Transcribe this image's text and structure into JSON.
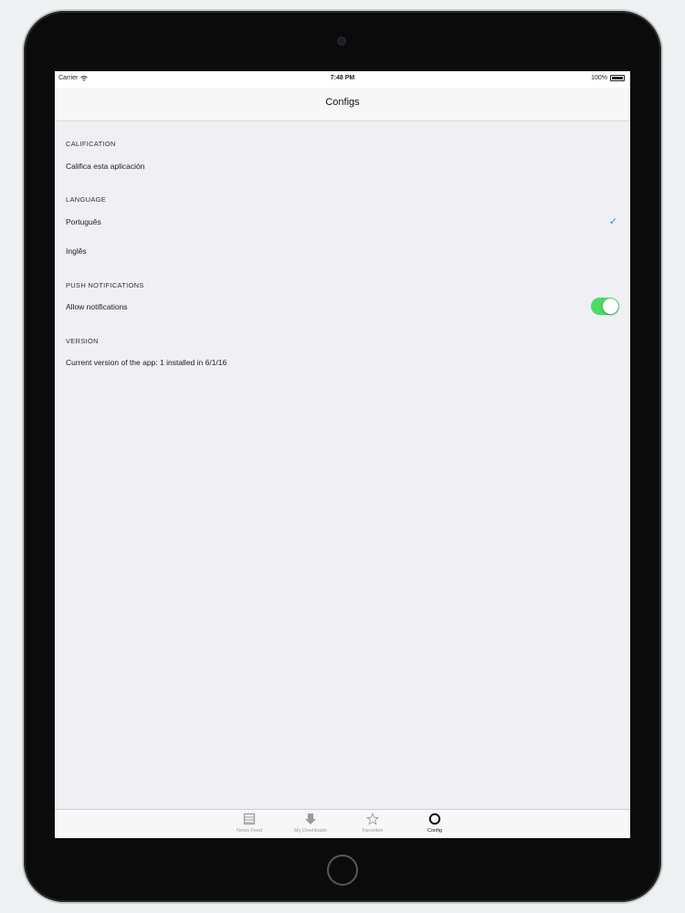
{
  "status_bar": {
    "carrier": "Carrier",
    "time": "7:48 PM",
    "battery": "100%"
  },
  "nav": {
    "title": "Configs"
  },
  "sections": {
    "calification": {
      "header": "CALIFICATION",
      "row_label": "Califica esta aplicación"
    },
    "language": {
      "header": "LANGUAGE",
      "options": [
        "Português",
        "Inglês"
      ],
      "selected": "Português"
    },
    "push": {
      "header": "PUSH NOTIFICATIONS",
      "row_label": "Allow notifications",
      "enabled": true
    },
    "version": {
      "header": "VERSION",
      "row_label": "Current version of the app: 1 installed in 6/1/16"
    }
  },
  "tab_bar": {
    "tabs": [
      {
        "label": "News Feed",
        "icon": "list-icon",
        "active": false
      },
      {
        "label": "My Downloads",
        "icon": "download-arrow-icon",
        "active": false
      },
      {
        "label": "Favorites",
        "icon": "star-icon",
        "active": false
      },
      {
        "label": "Config",
        "icon": "circle-icon",
        "active": true
      }
    ]
  },
  "colors": {
    "accent": "#2f7cf6",
    "toggle_on": "#4cd964",
    "screen_background": "#efeff4"
  }
}
